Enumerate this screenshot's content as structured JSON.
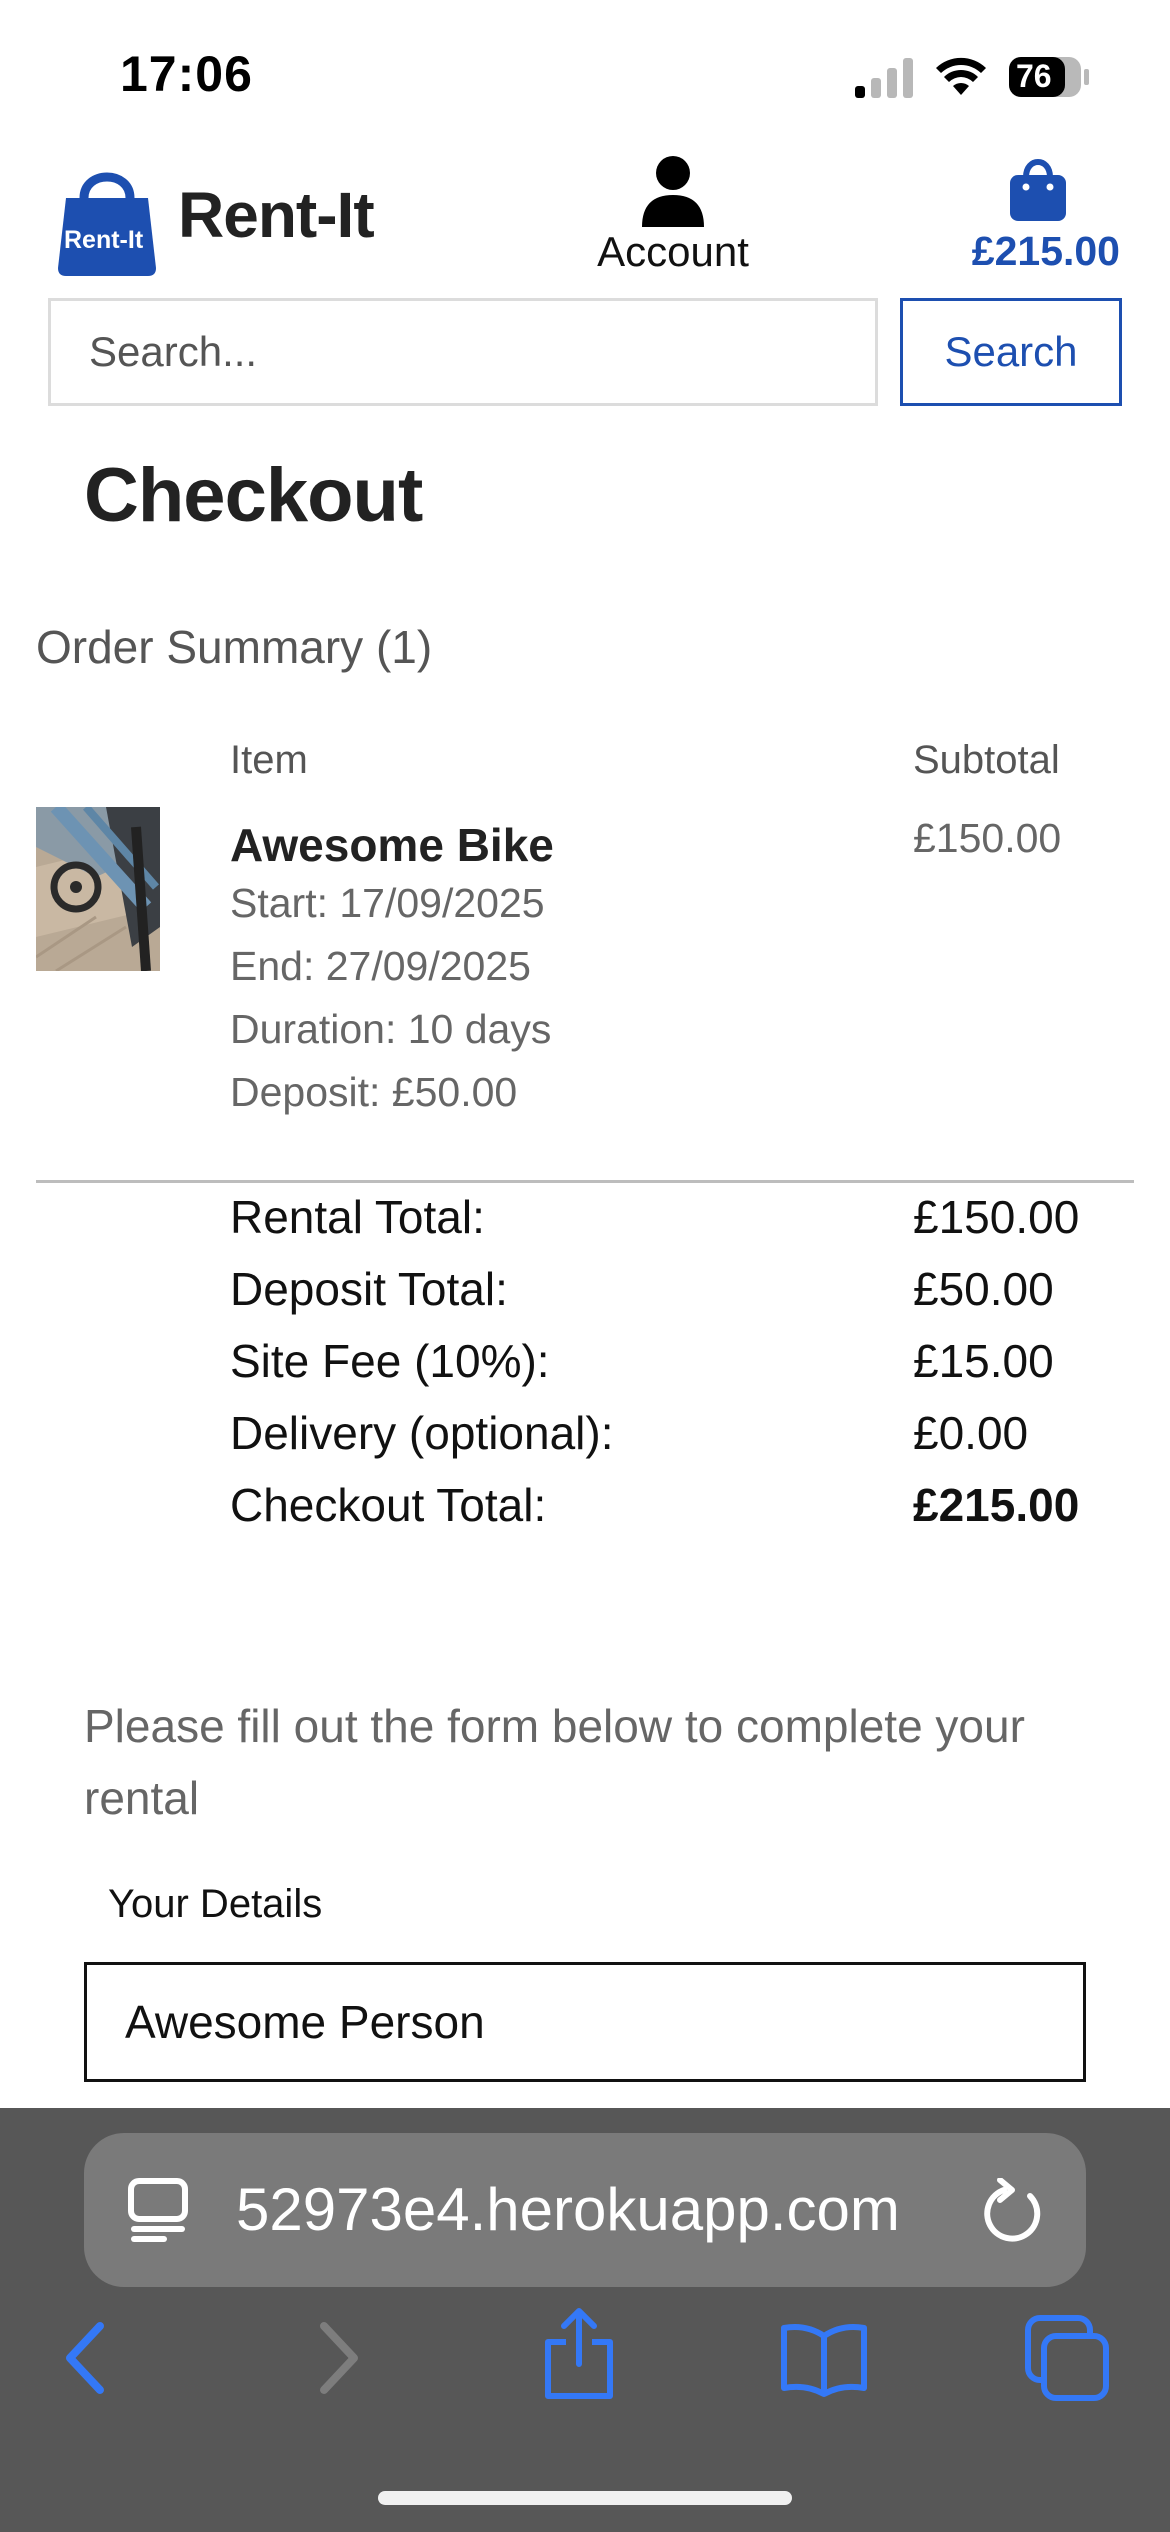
{
  "status_bar": {
    "time": "17:06",
    "battery": "76"
  },
  "header": {
    "brand": "Rent-It",
    "logo_text": "Rent-It",
    "account_label": "Account",
    "cart_total": "£215.00",
    "search": {
      "placeholder": "Search...",
      "button_label": "Search"
    }
  },
  "page": {
    "title": "Checkout"
  },
  "order_summary": {
    "heading": "Order Summary (1)",
    "col_item": "Item",
    "col_subtotal": "Subtotal",
    "items": [
      {
        "name": "Awesome Bike",
        "start": "Start: 17/09/2025",
        "end": "End: 27/09/2025",
        "duration": "Duration: 10 days",
        "deposit": "Deposit: £50.00",
        "subtotal": "£150.00"
      }
    ],
    "totals": [
      {
        "label": "Rental Total:",
        "value": "£150.00"
      },
      {
        "label": "Deposit Total:",
        "value": "£50.00"
      },
      {
        "label": "Site Fee (10%):",
        "value": "£15.00"
      },
      {
        "label": "Delivery (optional):",
        "value": "£0.00"
      },
      {
        "label": "Checkout Total:",
        "value": "£215.00"
      }
    ]
  },
  "form": {
    "intro": "Please fill out the form below to complete your rental",
    "section_label": "Your Details",
    "name_value": "Awesome Person"
  },
  "browser": {
    "url": "52973e4.herokuapp.com",
    "icons": [
      "reader-icon",
      "reload-icon",
      "back-icon",
      "forward-icon",
      "share-icon",
      "bookmarks-icon",
      "tabs-icon"
    ]
  },
  "colors": {
    "accent": "#1d4fb0",
    "browser_bar": "#575757"
  }
}
